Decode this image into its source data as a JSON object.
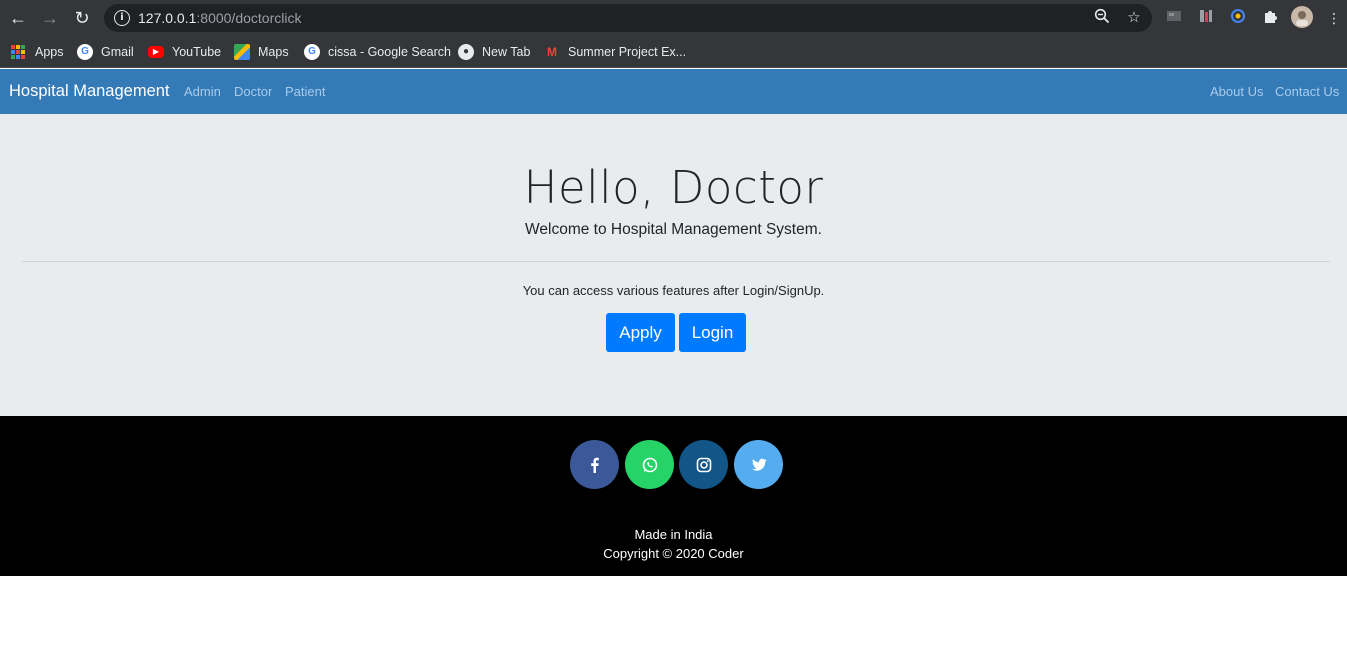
{
  "browser": {
    "url_host": "127.0.0.1",
    "url_path": ":8000/doctorclick",
    "bookmarks": [
      {
        "label": "Apps",
        "icon": "apps-grid-icon"
      },
      {
        "label": "Gmail",
        "icon": "google-icon"
      },
      {
        "label": "YouTube",
        "icon": "youtube-icon"
      },
      {
        "label": "Maps",
        "icon": "maps-icon"
      },
      {
        "label": "cissa - Google Search",
        "icon": "google-icon"
      },
      {
        "label": "New Tab",
        "icon": "globe-icon"
      },
      {
        "label": "Summer Project Ex...",
        "icon": "gmail-icon"
      }
    ]
  },
  "navbar": {
    "brand": "Hospital Management",
    "left_links": [
      "Admin",
      "Doctor",
      "Patient"
    ],
    "right_links": [
      "About Us",
      "Contact Us"
    ],
    "color": "#337ab7"
  },
  "jumbotron": {
    "title": "Hello, Doctor",
    "lead": "Welcome to Hospital Management System.",
    "note": "You can access various features after Login/SignUp.",
    "buttons": {
      "apply": "Apply",
      "login": "Login"
    },
    "button_color": "#007bff"
  },
  "footer": {
    "social": [
      {
        "name": "facebook-icon",
        "color": "#3b5998"
      },
      {
        "name": "whatsapp-icon",
        "color": "#25d366"
      },
      {
        "name": "instagram-icon",
        "color": "#125688"
      },
      {
        "name": "twitter-icon",
        "color": "#55acee"
      }
    ],
    "made_in": "Made in India",
    "copyright": "Copyright © 2020 Coder"
  }
}
